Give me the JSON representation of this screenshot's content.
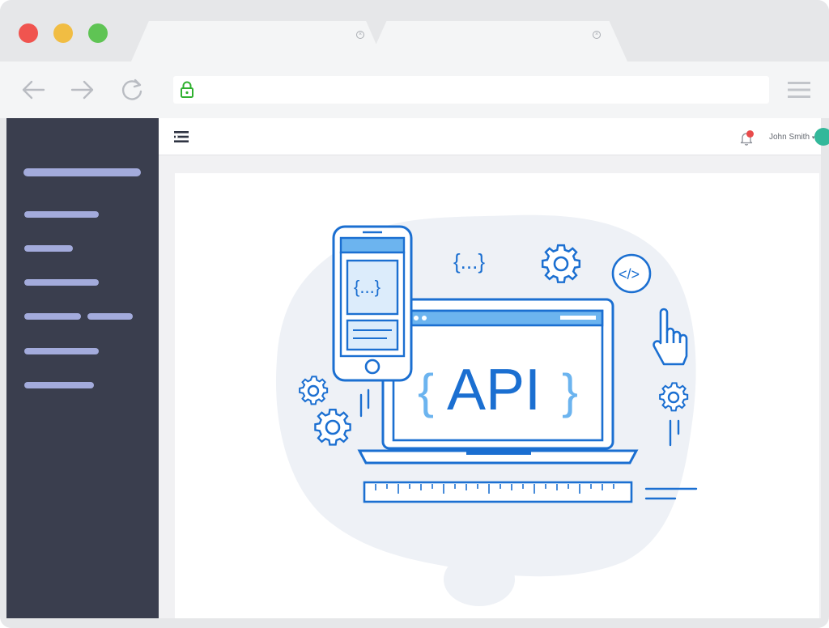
{
  "window": {
    "title": ""
  },
  "tabs": [
    {
      "label": ""
    },
    {
      "label": ""
    }
  ],
  "addressbar": {
    "url": ""
  },
  "appbar": {
    "user_name": "John Smith",
    "user_menu_caret": "▾",
    "notification_count": "1"
  },
  "illustration": {
    "main_label": "API",
    "brace_left": "{",
    "brace_right": "}",
    "phone_code": "{...}",
    "floating_code": "{...}",
    "code_badge": "</>"
  },
  "colors": {
    "sidebar_bg": "#3a3e4e",
    "sidebar_bar": "#a3abdc",
    "accent_blue": "#1b6fd1",
    "light_blue": "#6cb4ef",
    "blob": "#eef1f6"
  },
  "icons": {
    "back": "back-arrow-icon",
    "forward": "forward-arrow-icon",
    "reload": "reload-icon",
    "lock": "lock-icon",
    "menu": "menu-icon",
    "bell": "bell-icon"
  }
}
